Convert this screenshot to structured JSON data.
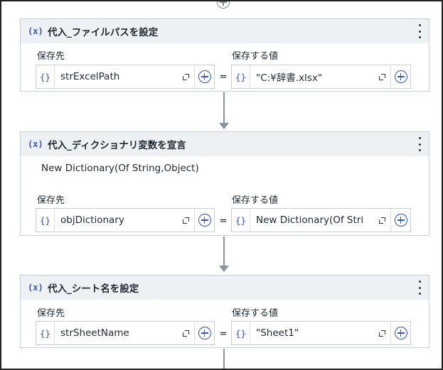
{
  "cards": [
    {
      "title": "代入_ファイルパスを設定",
      "to_label": "保存先",
      "value_label": "保存する値",
      "to_value": "strExcelPath",
      "value_value": "\"C:¥辞書.xlsx\""
    },
    {
      "title": "代入_ディクショナリ変数を宣言",
      "subtitle": "New Dictionary(Of String,Object)",
      "to_label": "保存先",
      "value_label": "保存する値",
      "to_value": "objDictionary",
      "value_value": "New Dictionary(Of Stri"
    },
    {
      "title": "代入_シート名を設定",
      "to_label": "保存先",
      "value_label": "保存する値",
      "to_value": "strSheetName",
      "value_value": "\"Sheet1\""
    }
  ],
  "glyphs": {
    "variable_icon": "(x)",
    "brace_icon": "{}",
    "equals": "="
  },
  "icons": [
    "add-activity-icon",
    "variable-x-icon",
    "more-options-icon",
    "expression-braces-icon",
    "expand-editor-icon",
    "plus-circle-icon",
    "flow-arrow-icon"
  ]
}
